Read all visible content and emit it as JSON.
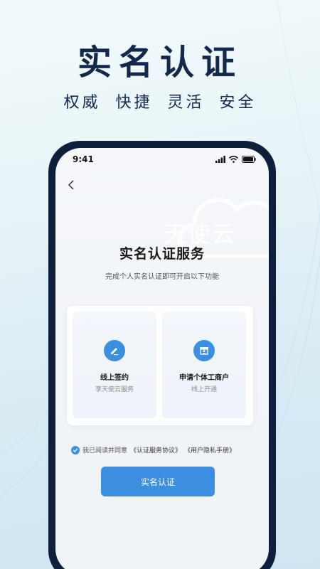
{
  "hero": {
    "title": "实名认证",
    "subtitle": "权威 快捷 灵活 安全"
  },
  "status_bar": {
    "time": "9:41",
    "icons": [
      "signal-icon",
      "wifi-icon",
      "battery-icon"
    ]
  },
  "watermark": {
    "text": "天使云"
  },
  "service": {
    "title": "实名认证服务",
    "description": "完成个人实名认证即可开启以下功能"
  },
  "features": [
    {
      "icon": "sign-pen-icon",
      "title": "线上签约",
      "subtitle": "享天使云服务"
    },
    {
      "icon": "merchant-icon",
      "title": "申请个体工商户",
      "subtitle": "线上开通"
    }
  ],
  "agreement": {
    "checked": true,
    "prefix": "我已阅读并同意",
    "link1": "《认证服务协议》",
    "link2": "《用户隐私手册》"
  },
  "submit": {
    "label": "实名认证"
  },
  "colors": {
    "primary": "#3b8ee0",
    "title": "#14284b",
    "phone_frame": "#0e1f3d"
  }
}
